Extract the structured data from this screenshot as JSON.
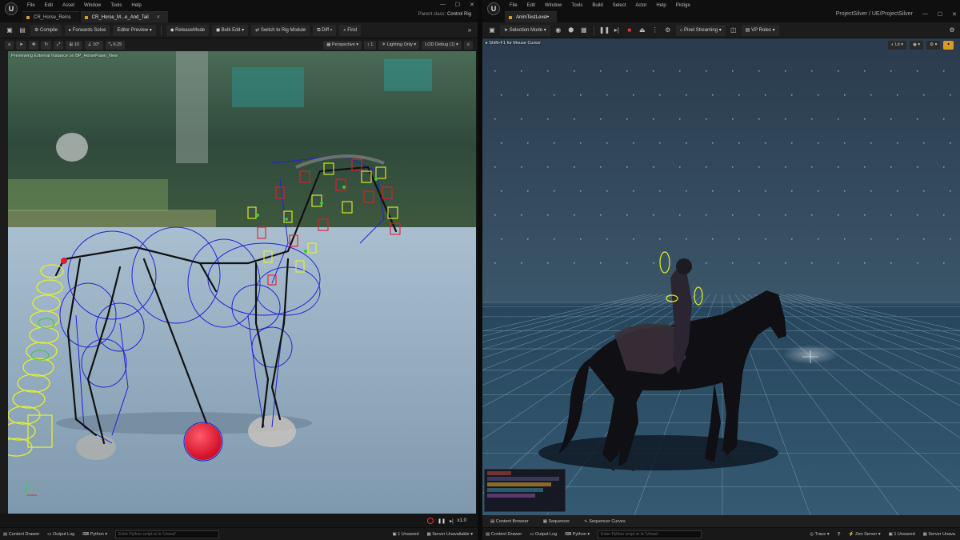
{
  "left": {
    "menu": [
      "File",
      "Edit",
      "Asset",
      "Window",
      "Tools",
      "Help"
    ],
    "tabs": [
      {
        "label": "CR_Horse_Reins",
        "active": false
      },
      {
        "label": "CR_Horse_M...e_And_Tail",
        "active": true
      }
    ],
    "parent_class_label": "Parent class:",
    "parent_class_value": "Control Rig",
    "toolbar": {
      "compile": "Compile",
      "forwards_solve": "Forwards Solve",
      "editor_preview": "Editor Preview",
      "release_mode": "ReleaseMode",
      "bulk_edit": "Bulk Edit",
      "switch_rig": "Switch to Rig Module",
      "diff": "Diff",
      "find": "Find"
    },
    "viewport_toolbar": {
      "grid_a": "10",
      "grid_b": "10°",
      "grid_c": "0.25",
      "perspective": "Perspective",
      "lighting": "Lighting Only",
      "lod": "LOD Debug (1)"
    },
    "viewport_message": "Previewing External Instance on BP_HorsePawn_New",
    "play_speed": "x1.0",
    "bottom": {
      "content_drawer": "Content Drawer",
      "output_log": "Output Log",
      "python": "Python",
      "cmd_placeholder": "Enter Python script or /e 'Unreal'",
      "unsaved": "1 Unsaved",
      "server": "Server Unavailable"
    }
  },
  "right": {
    "menu": [
      "File",
      "Edit",
      "Window",
      "Tools",
      "Build",
      "Select",
      "Actor",
      "Help",
      "Pistige"
    ],
    "tabs": [
      {
        "label": "AnimTestLevel•",
        "active": true
      }
    ],
    "project_path": "ProjectSilver / UE/ProjectSilver",
    "toolbar": {
      "selection_mode": "Selection Mode",
      "pixel_streaming": "Pixel Streaming",
      "vp_roles": "VP Roles"
    },
    "viewport_hint": "Shift+F1 for Mouse Cursor",
    "viewport_lit": "Lit",
    "seq": {
      "content_browser": "Content Browser",
      "sequencer": "Sequencer",
      "sequencer_curves": "Sequencer Curves"
    },
    "bottom": {
      "content_drawer": "Content Drawer",
      "output_log": "Output Log",
      "python": "Python",
      "cmd_placeholder": "Enter Python script or /e 'Unreal'",
      "trace": "Trace",
      "zen_server": "Zen Server",
      "unsaved": "1 Unsaved",
      "server": "Server Unava"
    }
  },
  "colors": {
    "accent_orange": "#d79a2b",
    "record_red": "#e33333",
    "bone_blue": "#2020d8",
    "control_yellow": "#e8ef2a",
    "control_red": "#e81b2b"
  }
}
